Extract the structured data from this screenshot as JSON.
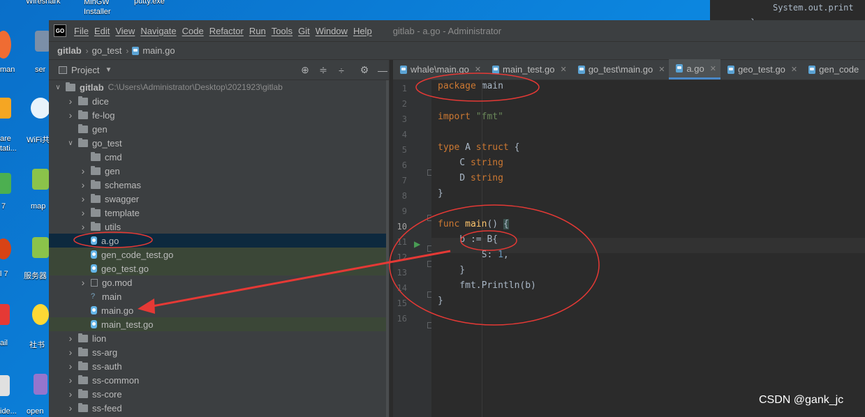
{
  "desktop": {
    "top_labels": [
      "Wireshark",
      "MinGW Installer",
      "putty.exe"
    ],
    "left_labels": [
      "man",
      "are tati...",
      "7",
      "l 7",
      "ail",
      "ide..."
    ],
    "second_col_labels": [
      "ser",
      "WiFi共享",
      "map",
      "服务器",
      "社书",
      "open"
    ]
  },
  "background_window": {
    "code_line": "System.out.print",
    "brace": "}",
    "comment": "//"
  },
  "ide": {
    "window_title": "gitlab - a.go - Administrator",
    "menu": [
      "File",
      "Edit",
      "View",
      "Navigate",
      "Code",
      "Refactor",
      "Run",
      "Tools",
      "Git",
      "Window",
      "Help"
    ],
    "breadcrumbs": [
      "gitlab",
      "go_test",
      "main.go"
    ],
    "project_panel": {
      "title": "Project",
      "root_name": "gitlab",
      "root_path": "C:\\Users\\Administrator\\Desktop\\2021923\\gitlab",
      "items": [
        {
          "label": "dice",
          "kind": "folder",
          "expandable": true,
          "depth": 1
        },
        {
          "label": "fe-log",
          "kind": "folder",
          "expandable": true,
          "depth": 1
        },
        {
          "label": "gen",
          "kind": "folder",
          "expandable": false,
          "depth": 1
        },
        {
          "label": "go_test",
          "kind": "folder",
          "expanded": true,
          "depth": 1
        },
        {
          "label": "cmd",
          "kind": "folder",
          "expandable": false,
          "depth": 2
        },
        {
          "label": "gen",
          "kind": "folder",
          "expandable": true,
          "depth": 2
        },
        {
          "label": "schemas",
          "kind": "folder",
          "expandable": true,
          "depth": 2
        },
        {
          "label": "swagger",
          "kind": "folder",
          "expandable": true,
          "depth": 2
        },
        {
          "label": "template",
          "kind": "folder",
          "expandable": true,
          "depth": 2
        },
        {
          "label": "utils",
          "kind": "folder",
          "expandable": true,
          "depth": 2
        },
        {
          "label": "a.go",
          "kind": "go",
          "depth": 2,
          "state": "selected"
        },
        {
          "label": "gen_code_test.go",
          "kind": "go",
          "depth": 2,
          "state": "highlight"
        },
        {
          "label": "geo_test.go",
          "kind": "go",
          "depth": 2,
          "state": "highlight"
        },
        {
          "label": "go.mod",
          "kind": "mod",
          "expandable": true,
          "depth": 2
        },
        {
          "label": "main",
          "kind": "unknown",
          "depth": 2
        },
        {
          "label": "main.go",
          "kind": "go",
          "depth": 2
        },
        {
          "label": "main_test.go",
          "kind": "go",
          "depth": 2,
          "state": "highlight"
        },
        {
          "label": "lion",
          "kind": "folder",
          "expandable": true,
          "depth": 1
        },
        {
          "label": "ss-arg",
          "kind": "folder",
          "expandable": true,
          "depth": 1
        },
        {
          "label": "ss-auth",
          "kind": "folder",
          "expandable": true,
          "depth": 1
        },
        {
          "label": "ss-common",
          "kind": "folder",
          "expandable": true,
          "depth": 1
        },
        {
          "label": "ss-core",
          "kind": "folder",
          "expandable": true,
          "depth": 1
        },
        {
          "label": "ss-feed",
          "kind": "folder",
          "expandable": true,
          "depth": 1
        }
      ]
    },
    "tabs": [
      {
        "label": "whale\\main.go",
        "active": false
      },
      {
        "label": "main_test.go",
        "active": false
      },
      {
        "label": "go_test\\main.go",
        "active": false
      },
      {
        "label": "a.go",
        "active": true
      },
      {
        "label": "geo_test.go",
        "active": false
      },
      {
        "label": "gen_code",
        "active": false
      }
    ],
    "line_numbers": [
      "1",
      "2",
      "3",
      "4",
      "5",
      "6",
      "7",
      "8",
      "9",
      "10",
      "11",
      "12",
      "13",
      "14",
      "15",
      "16"
    ]
  },
  "watermark": "CSDN @gank_jc",
  "colors": {
    "desktop_blue": "#0b78d4",
    "ide_dark": "#2b2b2b",
    "panel": "#3c3f41",
    "keyword": "#cc7832",
    "string": "#6a8759",
    "number": "#6897bb",
    "function": "#ffc66d",
    "annotation_red": "#e53935",
    "selection": "#0d293e"
  }
}
